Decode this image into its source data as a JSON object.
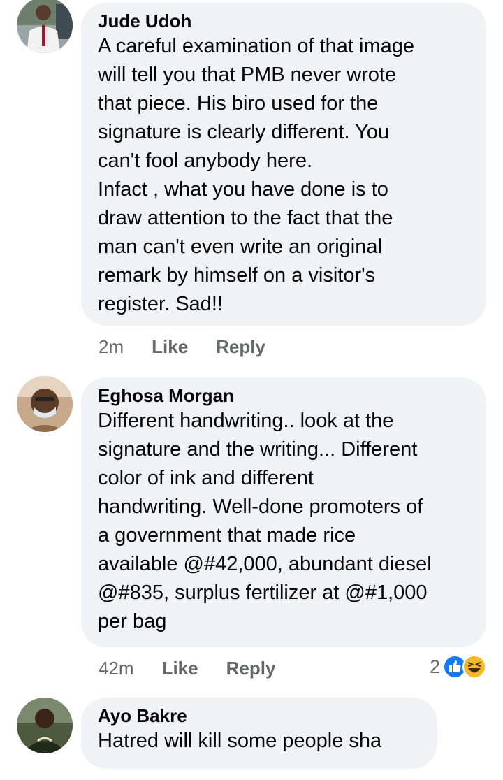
{
  "comments": [
    {
      "author": "Jude Udoh",
      "text": "A careful examination of that image\nwill tell you that PMB never wrote\nthat piece. His biro used for the\nsignature is clearly different. You\ncan't fool anybody here.\nInfact , what you have done is to\ndraw attention to the fact that the\nman can't even write an original\nremark by himself on a visitor's\nregister. Sad!!",
      "time": "2m",
      "like_label": "Like",
      "reply_label": "Reply"
    },
    {
      "author": "Eghosa Morgan",
      "text": "Different handwriting.. look at the\nsignature and the writing... Different\ncolor of ink and different\nhandwriting. Well-done promoters of\na government that made rice\navailable @#42,000, abundant diesel\n@#835, surplus fertilizer at @#1,000\nper bag",
      "time": "42m",
      "like_label": "Like",
      "reply_label": "Reply",
      "reaction_count": "2",
      "reactions": [
        "like-reaction-icon",
        "haha-reaction-icon"
      ]
    },
    {
      "author": "Ayo Bakre",
      "text": "Hatred will kill some people sha"
    }
  ],
  "colors": {
    "bubble": "#f0f2f5",
    "meta_text": "#65676b",
    "like_blue": "#1877f2",
    "haha_yellow": "#f7b928"
  }
}
